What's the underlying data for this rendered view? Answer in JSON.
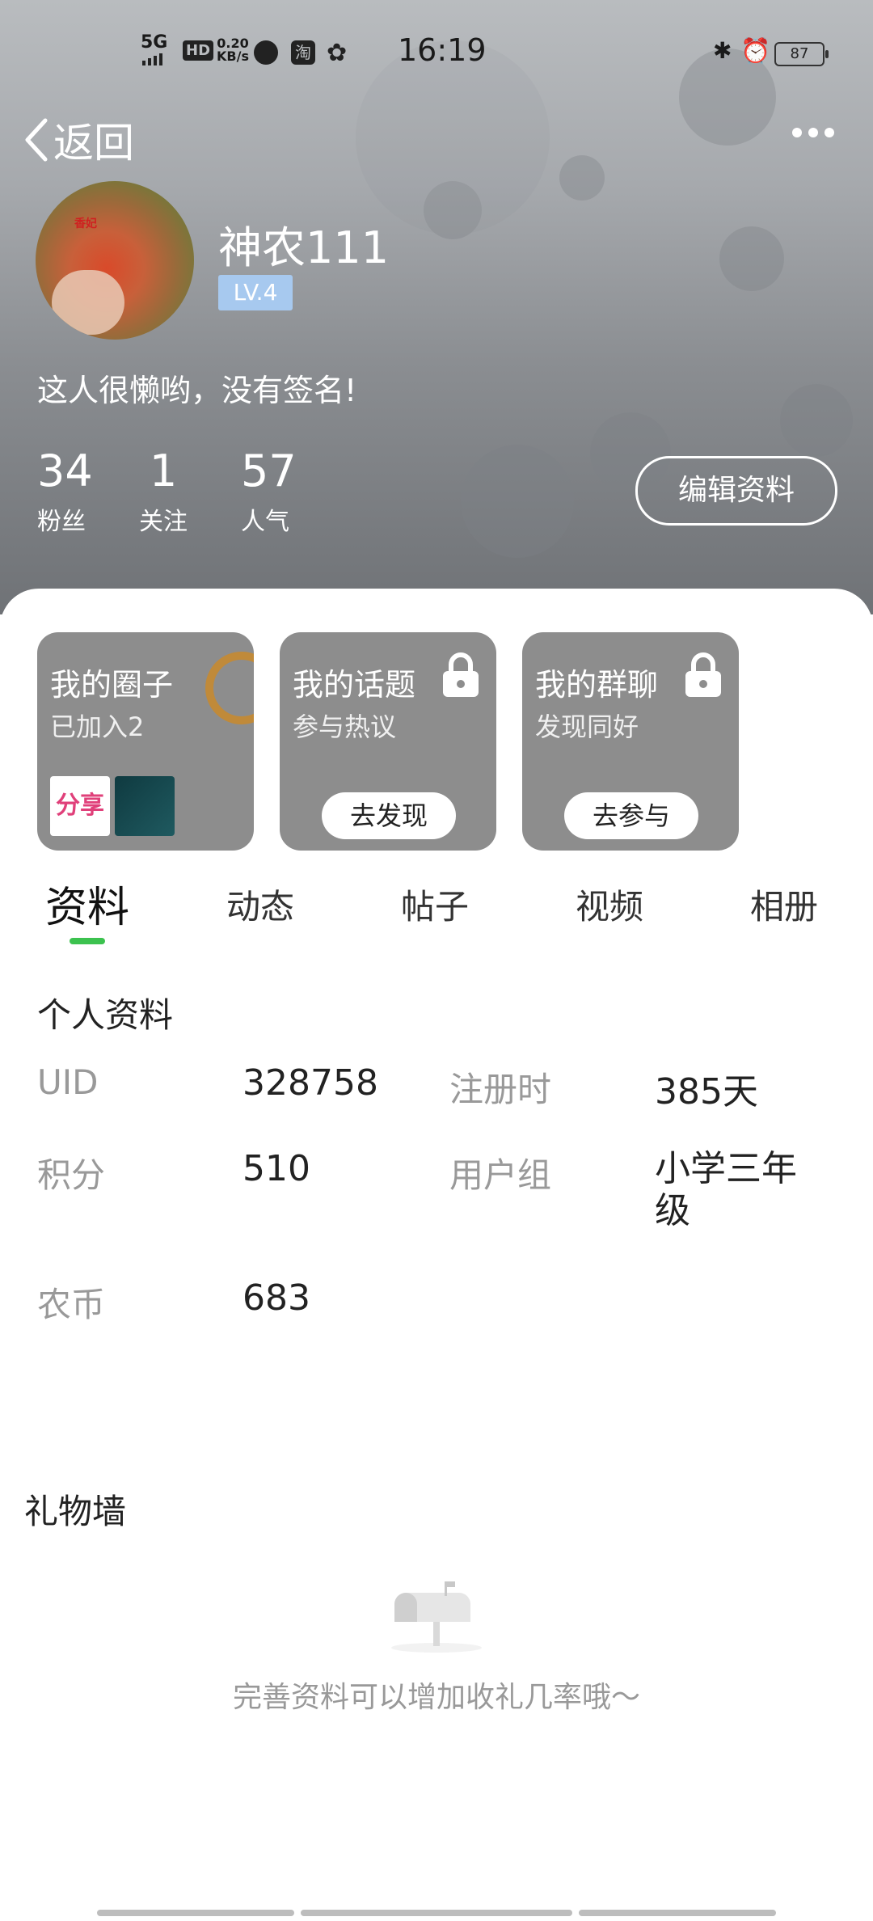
{
  "status_bar": {
    "network": "5G",
    "hd": "HD",
    "speed": "0.20",
    "speed_unit": "KB/s",
    "time": "16:19",
    "battery": "87"
  },
  "nav": {
    "back_label": "返回"
  },
  "profile": {
    "avatar_tag": "香妃",
    "username": "神农111",
    "level": "LV.4",
    "signature": "这人很懒哟，没有签名!",
    "stats": [
      {
        "value": "34",
        "label": "粉丝"
      },
      {
        "value": "1",
        "label": "关注"
      },
      {
        "value": "57",
        "label": "人气"
      }
    ],
    "edit_label": "编辑资料"
  },
  "cards": [
    {
      "title": "我的圈子",
      "subtitle": "已加入2",
      "thumb1": "分享"
    },
    {
      "title": "我的话题",
      "subtitle": "参与热议",
      "button": "去发现"
    },
    {
      "title": "我的群聊",
      "subtitle": "发现同好",
      "button": "去参与"
    }
  ],
  "tabs": [
    "资料",
    "动态",
    "帖子",
    "视频",
    "相册"
  ],
  "personal_info": {
    "title": "个人资料",
    "fields": [
      {
        "label": "UID",
        "value": "328758"
      },
      {
        "label": "注册时",
        "value": "385天"
      },
      {
        "label": "积分",
        "value": "510"
      },
      {
        "label": "用户组",
        "value": "小学三年级"
      },
      {
        "label": "农币",
        "value": "683"
      }
    ]
  },
  "gift_wall": {
    "title": "礼物墙",
    "empty_text": "完善资料可以增加收礼几率哦～"
  },
  "colors": {
    "accent_green": "#3cc24f",
    "level_badge": "#a7c9ef",
    "card_gray": "#8d8d8d"
  }
}
